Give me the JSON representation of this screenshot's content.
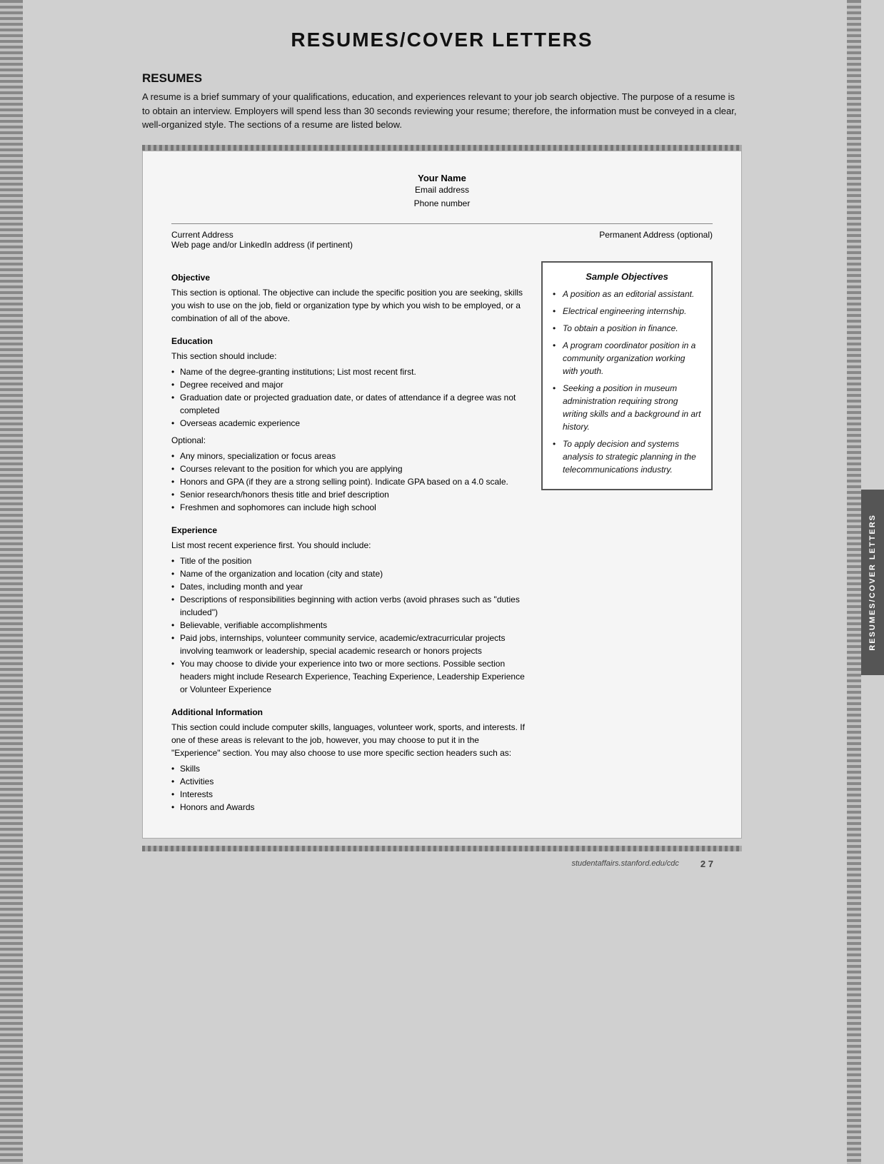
{
  "page": {
    "title": "RESUMES/COVER LETTERS",
    "section_title": "RESUMES",
    "intro": "A resume is a brief summary of your qualifications, education, and experiences relevant to your job search objective. The purpose of a resume is to obtain an interview. Employers will spend less than 30 seconds reviewing your resume; therefore, the information must be conveyed in a clear, well-organized style. The sections of a resume are listed below."
  },
  "resume_template": {
    "your_name": "Your Name",
    "email": "Email address",
    "phone": "Phone number",
    "current_address": "Current Address",
    "web": "Web page and/or LinkedIn address (if pertinent)",
    "permanent_address": "Permanent Address (optional)",
    "sections": {
      "objective": {
        "title": "Objective",
        "text": "This section is optional. The objective can include the specific position you are seeking, skills you wish to use on the job, field or organization type by which you wish to be employed, or a combination of all of the above."
      },
      "education": {
        "title": "Education",
        "intro": "This section should include:",
        "items": [
          "Name of the degree-granting institutions; List most recent first.",
          "Degree received and major",
          "Graduation date or projected graduation date, or dates of attendance if a degree was not completed",
          "Overseas academic experience"
        ],
        "optional_label": "Optional:",
        "optional_items": [
          "Any minors, specialization or focus areas",
          "Courses relevant to the position for which you are applying",
          "Honors and GPA (if they are a strong selling point). Indicate GPA based on a 4.0 scale.",
          "Senior research/honors thesis title and brief description",
          "Freshmen and sophomores can include high school"
        ]
      },
      "experience": {
        "title": "Experience",
        "intro": "List most recent experience first. You should include:",
        "items": [
          "Title of the position",
          "Name of the organization and location (city and state)",
          "Dates, including month and year",
          "Descriptions of responsibilities beginning with action verbs (avoid phrases such as \"duties included\")",
          "Believable, verifiable accomplishments",
          "Paid jobs, internships, volunteer community service, academic/extracurricular projects involving teamwork or leadership, special academic research or honors projects",
          "You may choose to divide your experience into two or more sections. Possible section headers might include Research Experience, Teaching Experience, Leadership Experience or Volunteer Experience"
        ]
      },
      "additional": {
        "title": "Additional Information",
        "text": "This section could include computer skills, languages, volunteer work, sports, and interests. If one of these areas is relevant to the job, however, you may choose to put it in the \"Experience\" section. You may also choose to use more specific section headers such as:",
        "items": [
          "Skills",
          "Activities",
          "Interests",
          "Honors and Awards"
        ]
      }
    }
  },
  "sample_objectives": {
    "title": "Sample Objectives",
    "items": [
      "A position as an editorial assistant.",
      "Electrical engineering internship.",
      "To obtain a position in finance.",
      "A program coordinator position in a community organization working with youth.",
      "Seeking a position in museum administration requiring strong writing skills and a background in art history.",
      "To apply decision and systems analysis to strategic planning in the telecommunications industry."
    ]
  },
  "side_tab": {
    "label": "RESUMES/COVER LETTERS"
  },
  "footer": {
    "url": "studentaffairs.stanford.edu/cdc",
    "page": "2 7"
  }
}
